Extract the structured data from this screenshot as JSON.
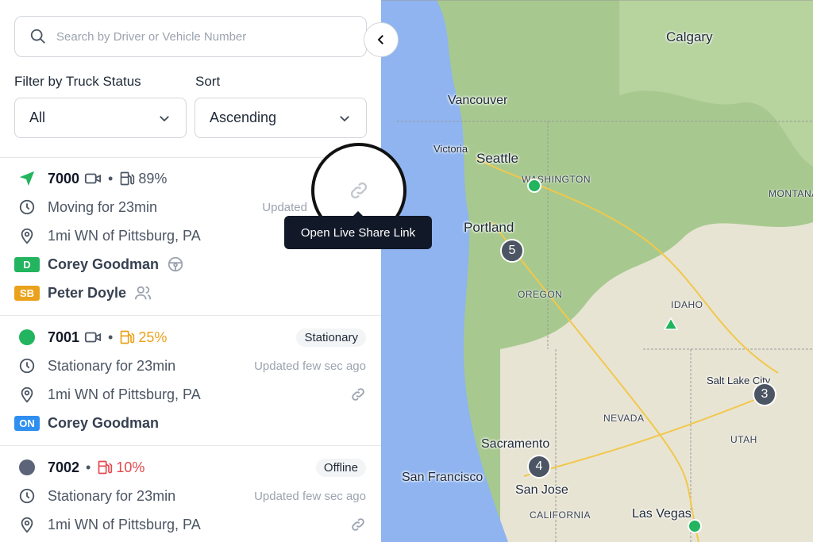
{
  "search": {
    "placeholder": "Search by Driver or Vehicle Number"
  },
  "filters": {
    "status_label": "Filter by Truck Status",
    "status_value": "All",
    "sort_label": "Sort",
    "sort_value": "Ascending"
  },
  "tooltip": "Open Live Share Link",
  "colors": {
    "green": "#22b45e",
    "amber": "#eaa21b",
    "red": "#e5484d",
    "blue": "#2f8ff0",
    "gray": "#5b6478"
  },
  "vehicles": [
    {
      "number": "7000",
      "fuel": "89%",
      "status_icon": "navigation-arrow-icon",
      "duration": "Moving for 23min",
      "updated": "Updated",
      "location": "1mi WN of Pittsburg, PA",
      "driver_badge": "D",
      "driver": "Corey Goodman",
      "codriver_badge": "SB",
      "codriver": "Peter Doyle"
    },
    {
      "number": "7001",
      "fuel": "25%",
      "status": "Stationary",
      "duration": "Stationary for 23min",
      "updated": "Updated few sec ago",
      "location": "1mi WN of Pittsburg, PA",
      "driver_badge": "ON",
      "driver": "Corey Goodman"
    },
    {
      "number": "7002",
      "fuel": "10%",
      "status": "Offline",
      "duration": "Stationary for 23min",
      "updated": "Updated few sec ago",
      "location": "1mi WN of Pittsburg, PA"
    }
  ],
  "map": {
    "cities": [
      "Calgary",
      "Vancouver",
      "Victoria",
      "Seattle",
      "Portland",
      "Salt Lake City",
      "Sacramento",
      "San Francisco",
      "San Jose",
      "Las Vegas"
    ],
    "states": [
      "WASHINGTON",
      "MONTANA",
      "OREGON",
      "IDAHO",
      "NEVADA",
      "UTAH",
      "CALIFORNIA"
    ],
    "clusters": [
      "5",
      "4",
      "3"
    ]
  }
}
